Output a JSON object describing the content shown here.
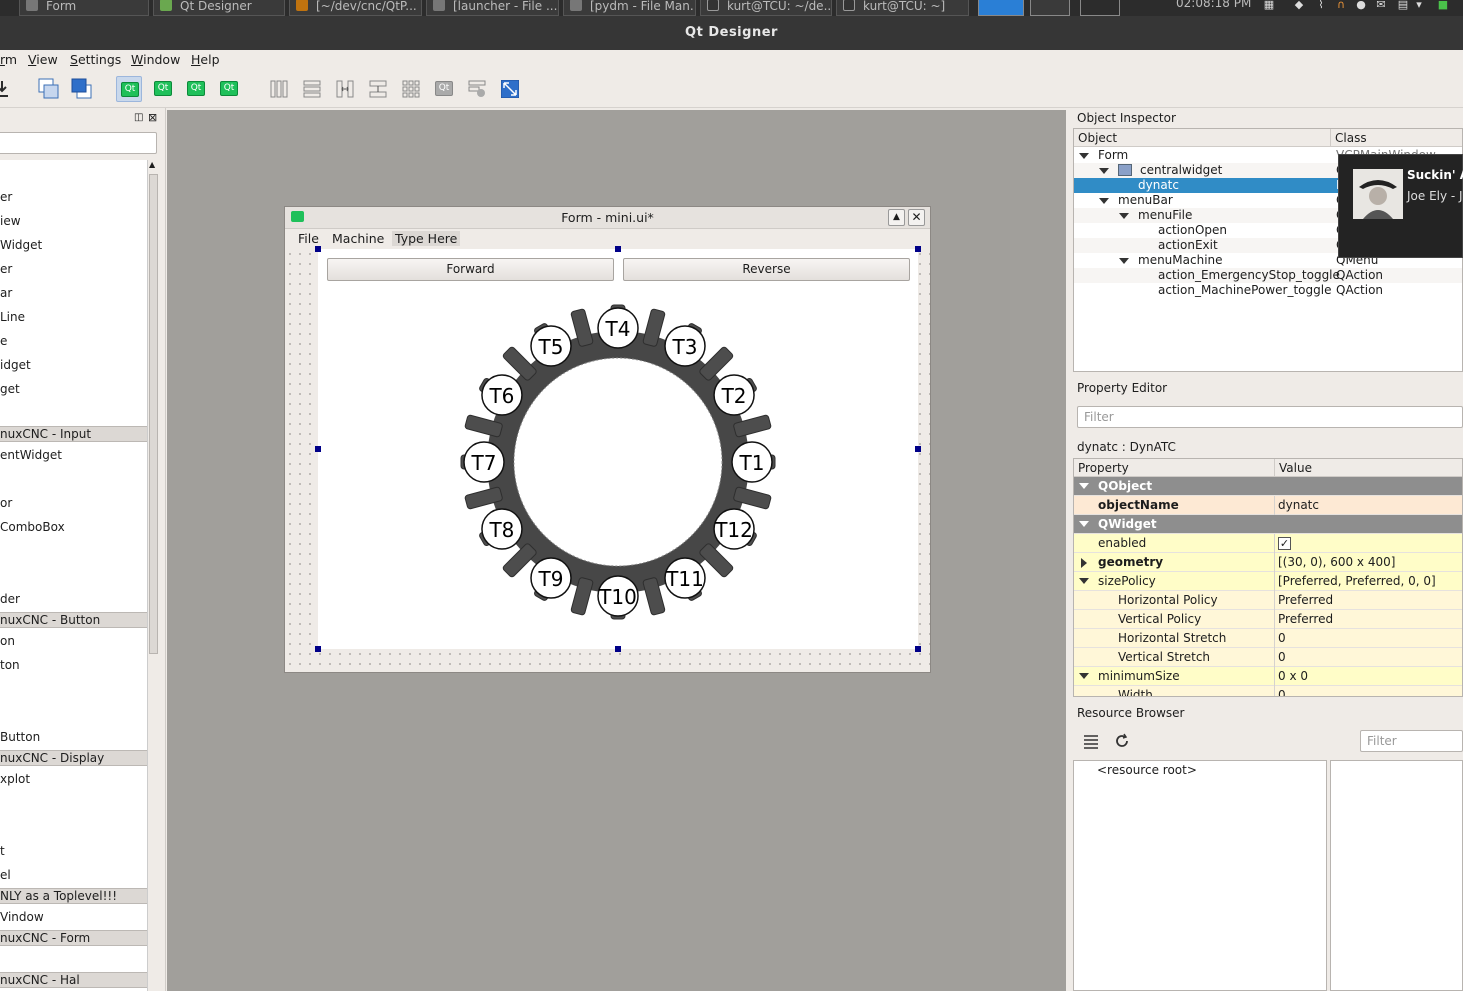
{
  "taskbar": {
    "tasks": [
      "Form",
      "Qt Designer",
      "[~/dev/cnc/QtP...",
      "[launcher - File ...",
      "[pydm - File Man...",
      "kurt@TCU: ~/de...",
      "kurt@TCU: ~]"
    ],
    "clock": "02:08:18 PM"
  },
  "window": {
    "title": "Qt Designer"
  },
  "menubar": {
    "items": [
      "rm",
      "View",
      "Settings",
      "Window",
      "Help"
    ]
  },
  "toolbar": {
    "qt_label": "Qt"
  },
  "widget_box": {
    "items_a": [
      "er",
      "iew",
      "Widget",
      "er",
      "ar",
      "Line",
      "e",
      "idget",
      "get"
    ],
    "header_input": "nuxCNC - Input",
    "items_b": [
      "entWidget",
      "",
      "or",
      "ComboBox"
    ],
    "item_der": "der",
    "header_button": "nuxCNC - Button",
    "items_c": [
      "on",
      "ton",
      "Button"
    ],
    "header_display": "nuxCNC - Display",
    "items_d": [
      "xplot",
      "t",
      "el"
    ],
    "header_toplevel": "NLY as a Toplevel!!!",
    "item_window": "Vindow",
    "header_form": "nuxCNC - Form",
    "header_hal": "nuxCNC - Hal"
  },
  "form": {
    "title": "Form - mini.ui*",
    "menu": [
      "File",
      "Machine",
      "Type Here"
    ],
    "forward_label": "Forward",
    "reverse_label": "Reverse",
    "tools": [
      "T1",
      "T2",
      "T3",
      "T4",
      "T5",
      "T6",
      "T7",
      "T8",
      "T9",
      "T10",
      "T11",
      "T12"
    ]
  },
  "object_inspector": {
    "title": "Object Inspector",
    "col_object": "Object",
    "col_class": "Class",
    "rows": [
      {
        "name": "Form",
        "cls": "VCPMainWindow"
      },
      {
        "name": "centralwidget",
        "cls": "Q"
      },
      {
        "name": "dynatc",
        "cls": "D"
      },
      {
        "name": "menuBar",
        "cls": "Q"
      },
      {
        "name": "menuFile",
        "cls": "Q"
      },
      {
        "name": "actionOpen",
        "cls": "QAction"
      },
      {
        "name": "actionExit",
        "cls": "QAction"
      },
      {
        "name": "menuMachine",
        "cls": "QMenu"
      },
      {
        "name": "action_EmergencyStop_toggle",
        "cls": "QAction"
      },
      {
        "name": "action_MachinePower_toggle",
        "cls": "QAction"
      }
    ]
  },
  "property_editor": {
    "title": "Property Editor",
    "filter_placeholder": "Filter",
    "object_label": "dynatc : DynATC",
    "col_property": "Property",
    "col_value": "Value",
    "group_qobject": "QObject",
    "object_name_label": "objectName",
    "object_name_value": "dynatc",
    "group_qwidget": "QWidget",
    "enabled_label": "enabled",
    "enabled_value": "✓",
    "geometry_label": "geometry",
    "geometry_value": "[(30, 0), 600 x 400]",
    "size_policy_label": "sizePolicy",
    "size_policy_value": "[Preferred, Preferred, 0, 0]",
    "hpolicy_label": "Horizontal Policy",
    "hpolicy_value": "Preferred",
    "vpolicy_label": "Vertical Policy",
    "vpolicy_value": "Preferred",
    "hstretch_label": "Horizontal Stretch",
    "hstretch_value": "0",
    "vstretch_label": "Vertical Stretch",
    "vstretch_value": "0",
    "minsize_label": "minimumSize",
    "minsize_value": "0 x 0",
    "width_label": "Width",
    "width_value": "0"
  },
  "resource_browser": {
    "title": "Resource Browser",
    "filter_placeholder": "Filter",
    "root": "<resource root>"
  },
  "notification": {
    "title": "Suckin' A",
    "artist": "Joe Ely - J"
  }
}
